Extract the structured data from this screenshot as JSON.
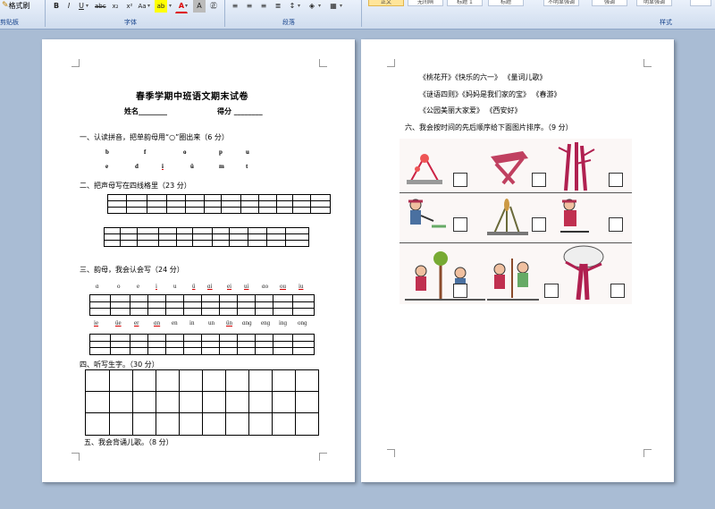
{
  "ribbon": {
    "format_painter": "格式刷",
    "clipboard_label": "剪贴板",
    "font_label": "字体",
    "paragraph_label": "段落",
    "styles_label": "样式",
    "bold": "B",
    "italic": "I",
    "underline": "U",
    "strike": "abc",
    "subscript": "x₂",
    "superscript": "x²",
    "change_case": "Aa",
    "font_color": "A",
    "char_shade": "A",
    "style_items": [
      "正文",
      "无间隔",
      "标题 1",
      "标题",
      "不明显强调",
      "强调",
      "明显强调"
    ]
  },
  "left_page": {
    "title": "春季学期中班语文期末试卷",
    "name_label": "姓名________",
    "score_label": "得分  ________",
    "s1": "一、认读拼音，把单韵母用“○”圈出来（6 分）",
    "s1_row1": [
      "b",
      "f",
      "o",
      "p",
      "u"
    ],
    "s1_row2": [
      "e",
      "d",
      "i",
      "ü",
      "m",
      "t"
    ],
    "s2": "二、把声母写在四线格里（23 分）",
    "s3": "三、韵母，我会认会写（24 分）",
    "s3_row1": [
      "ɑ",
      "o",
      "e",
      "i",
      "u",
      "ü",
      "ɑi",
      "ei",
      "ui",
      "ɑo",
      "ou",
      "iu"
    ],
    "s3_row2": [
      "ie",
      "üe",
      "er",
      "ɑn",
      "en",
      "in",
      "un",
      "ün",
      "ɑnɡ",
      "enɡ",
      "inɡ",
      "onɡ"
    ],
    "s4": "四、听写生字。（30 分）",
    "s5": "五、我会背诵儿歌。（8 分）"
  },
  "right_page": {
    "line1": "《桃花开》《快乐的六一》 《量词儿歌》",
    "line2": "《谜语四则》《妈妈是我们家的宝》 《春游》",
    "line3": "《公园美丽大家爱》 《西安好》",
    "s6": "六、我会按时间的先后顺序给下面图片排序。（9 分）"
  }
}
